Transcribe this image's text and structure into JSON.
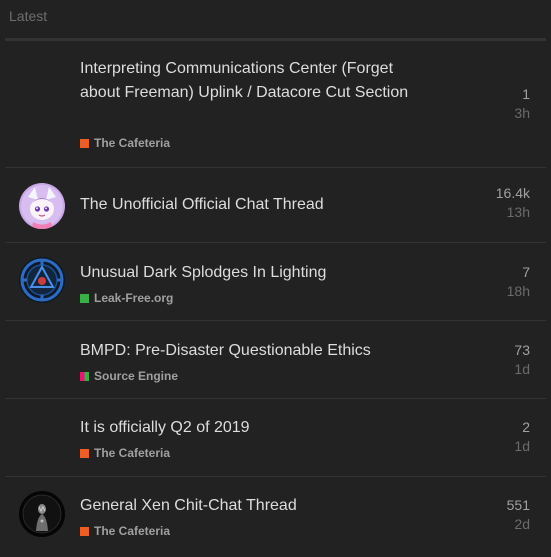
{
  "header": {
    "title": "Latest"
  },
  "topics": [
    {
      "title": "Interpreting Communications Center (Forget about Freeman) Uplink / Datacore Cut Section",
      "category": "The Cafeteria",
      "category_color": "#ed5d24",
      "replies": "1",
      "activity": "3h",
      "avatar": "none"
    },
    {
      "title": "The Unofficial Official Chat Thread",
      "category": "",
      "category_color": "",
      "replies": "16.4k",
      "activity": "13h",
      "avatar": "anime-character-avatar"
    },
    {
      "title": "Unusual Dark Splodges In Lighting",
      "category": "Leak-Free.org",
      "category_color": "#38b045",
      "replies": "7",
      "activity": "18h",
      "avatar": "blue-emblem-avatar"
    },
    {
      "title": "BMPD: Pre-Disaster Questionable Ethics",
      "category": "Source Engine",
      "category_color": "#e9156e",
      "replies": "73",
      "activity": "1d",
      "avatar": "none"
    },
    {
      "title": "It is officially Q2 of 2019",
      "category": "The Cafeteria",
      "category_color": "#ed5d24",
      "replies": "2",
      "activity": "1d",
      "avatar": "none"
    },
    {
      "title": "General Xen Chit-Chat Thread",
      "category": "The Cafeteria",
      "category_color": "#ed5d24",
      "replies": "551",
      "activity": "2d",
      "avatar": "dark-figure-avatar"
    }
  ]
}
